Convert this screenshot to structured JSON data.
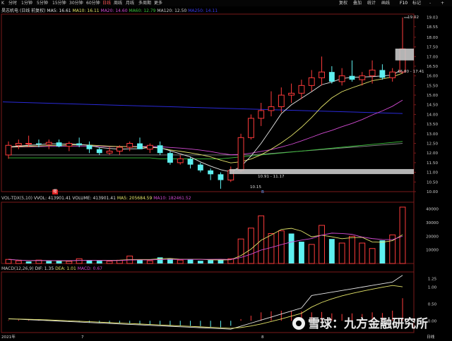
{
  "toolbar": {
    "back": "K",
    "tabs": [
      "分时",
      "1分钟",
      "5分钟",
      "15分钟",
      "30分钟",
      "60分钟",
      "日线",
      "周线",
      "月线",
      "多周期",
      "更多"
    ],
    "active_tab": "日线",
    "right_buttons": [
      "复权",
      "叠加",
      "统计",
      "画线",
      "F10",
      "标记",
      "-",
      "+"
    ]
  },
  "ma_info": {
    "stock": "昊志机电 (日线 前复权)",
    "ma5": "MA5: 16.61",
    "ma10": "MA10: 16.11",
    "ma20": "MA20: 14.60",
    "ma60": "MA60: 12.79",
    "ma120": "MA120: 12.50",
    "ma250": "MA250: 14.11"
  },
  "vol_info": {
    "title": "VOL-TDX(5,10)",
    "vvol": "VVOL: 413901.41",
    "volume": "VOLUME: 413901.41",
    "ma5": "MA5: 205684.59",
    "ma10": "MA10: 182461.52"
  },
  "macd_info": {
    "title": "MACD(12,26,9)",
    "dif": "DIF: 1.35",
    "dea": "DEA: 1.01",
    "macd": "MACD: 0.67"
  },
  "price_axis": [
    "19.03",
    "18.55",
    "18.00",
    "17.50",
    "17.00",
    "16.50",
    "16.00",
    "15.50",
    "15.00",
    "14.50",
    "14.00",
    "13.50",
    "13.00",
    "12.50",
    "12.00",
    "11.50",
    "11.00",
    "10.50",
    "10.00"
  ],
  "vol_axis": [
    "40000",
    "30000",
    "20000",
    "10000"
  ],
  "macd_axis": [
    "1.25",
    "1.00",
    "0.50",
    "0.00"
  ],
  "annotations": {
    "high": "19.02",
    "zone_high": "16.80 - 17.41",
    "zone_low": "10.91 - 11.17",
    "low": "10.15",
    "event_mark": "增",
    "event_mark2": "B"
  },
  "x_labels": [
    "2021年",
    "7",
    "8"
  ],
  "bottom_right": "日线",
  "watermark": "雪球：九方金融研究所",
  "colors": {
    "up": "#ff3b3b",
    "down": "#5ef0f0",
    "ma5": "#e8e8e8",
    "ma10": "#e6e66a",
    "ma20": "#d24bd2",
    "ma60": "#3cc43c",
    "ma120": "#8a8a8a",
    "ma250": "#2a2ad8",
    "zone": "#c8c8c8"
  },
  "chart_data": {
    "type": "candlestick",
    "candles": [
      {
        "o": 11.9,
        "h": 12.6,
        "l": 11.7,
        "c": 12.4
      },
      {
        "o": 12.4,
        "h": 12.7,
        "l": 12.2,
        "c": 12.5
      },
      {
        "o": 12.5,
        "h": 12.9,
        "l": 12.3,
        "c": 12.5
      },
      {
        "o": 12.5,
        "h": 12.7,
        "l": 12.3,
        "c": 12.45
      },
      {
        "o": 12.45,
        "h": 12.7,
        "l": 12.2,
        "c": 12.55
      },
      {
        "o": 12.55,
        "h": 12.7,
        "l": 12.3,
        "c": 12.35
      },
      {
        "o": 12.35,
        "h": 12.6,
        "l": 12.1,
        "c": 12.5
      },
      {
        "o": 12.5,
        "h": 12.8,
        "l": 12.3,
        "c": 12.4
      },
      {
        "o": 12.4,
        "h": 12.6,
        "l": 12.0,
        "c": 12.2
      },
      {
        "o": 12.2,
        "h": 12.3,
        "l": 11.9,
        "c": 12.0
      },
      {
        "o": 12.0,
        "h": 12.3,
        "l": 11.9,
        "c": 12.1
      },
      {
        "o": 12.1,
        "h": 12.4,
        "l": 11.9,
        "c": 12.3
      },
      {
        "o": 12.3,
        "h": 12.6,
        "l": 12.1,
        "c": 12.5
      },
      {
        "o": 12.5,
        "h": 12.8,
        "l": 12.3,
        "c": 12.2
      },
      {
        "o": 12.2,
        "h": 12.5,
        "l": 12.0,
        "c": 12.4
      },
      {
        "o": 12.4,
        "h": 12.6,
        "l": 11.9,
        "c": 12.0
      },
      {
        "o": 12.0,
        "h": 12.1,
        "l": 11.4,
        "c": 11.5
      },
      {
        "o": 11.5,
        "h": 11.9,
        "l": 11.4,
        "c": 11.7
      },
      {
        "o": 11.7,
        "h": 11.8,
        "l": 11.2,
        "c": 11.4
      },
      {
        "o": 11.4,
        "h": 11.5,
        "l": 11.0,
        "c": 11.1
      },
      {
        "o": 11.1,
        "h": 11.2,
        "l": 10.6,
        "c": 10.9
      },
      {
        "o": 10.9,
        "h": 11.0,
        "l": 10.15,
        "c": 10.6
      },
      {
        "o": 10.6,
        "h": 11.3,
        "l": 10.5,
        "c": 11.1
      },
      {
        "o": 11.1,
        "h": 13.0,
        "l": 11.0,
        "c": 12.8
      },
      {
        "o": 12.8,
        "h": 14.0,
        "l": 12.7,
        "c": 13.8
      },
      {
        "o": 13.8,
        "h": 14.6,
        "l": 13.4,
        "c": 14.2
      },
      {
        "o": 14.2,
        "h": 15.2,
        "l": 13.9,
        "c": 14.4
      },
      {
        "o": 14.4,
        "h": 15.4,
        "l": 14.1,
        "c": 15.0
      },
      {
        "o": 15.0,
        "h": 15.6,
        "l": 14.6,
        "c": 15.1
      },
      {
        "o": 15.1,
        "h": 15.8,
        "l": 14.8,
        "c": 15.5
      },
      {
        "o": 15.5,
        "h": 16.3,
        "l": 15.2,
        "c": 15.9
      },
      {
        "o": 15.9,
        "h": 17.0,
        "l": 15.5,
        "c": 16.2
      },
      {
        "o": 16.2,
        "h": 16.5,
        "l": 15.6,
        "c": 15.7
      },
      {
        "o": 15.7,
        "h": 16.4,
        "l": 15.5,
        "c": 16.0
      },
      {
        "o": 16.0,
        "h": 16.8,
        "l": 15.7,
        "c": 15.8
      },
      {
        "o": 15.8,
        "h": 16.2,
        "l": 15.5,
        "c": 16.0
      },
      {
        "o": 16.0,
        "h": 16.8,
        "l": 15.6,
        "c": 16.3
      },
      {
        "o": 16.3,
        "h": 16.6,
        "l": 15.8,
        "c": 15.9
      },
      {
        "o": 15.9,
        "h": 16.4,
        "l": 15.7,
        "c": 16.2
      },
      {
        "o": 16.2,
        "h": 19.02,
        "l": 16.1,
        "c": 17.4
      }
    ],
    "volume": [
      {
        "v": 3000,
        "up": true
      },
      {
        "v": 2000,
        "up": true
      },
      {
        "v": 1500,
        "up": false
      },
      {
        "v": 2500,
        "up": true
      },
      {
        "v": 1800,
        "up": false
      },
      {
        "v": 2200,
        "up": false
      },
      {
        "v": 1600,
        "up": true
      },
      {
        "v": 3500,
        "up": true
      },
      {
        "v": 2600,
        "up": false
      },
      {
        "v": 2000,
        "up": false
      },
      {
        "v": 1700,
        "up": true
      },
      {
        "v": 2400,
        "up": true
      },
      {
        "v": 5500,
        "up": true
      },
      {
        "v": 3000,
        "up": false
      },
      {
        "v": 2000,
        "up": true
      },
      {
        "v": 4500,
        "up": false
      },
      {
        "v": 3500,
        "up": false
      },
      {
        "v": 2500,
        "up": true
      },
      {
        "v": 3000,
        "up": false
      },
      {
        "v": 2000,
        "up": false
      },
      {
        "v": 2500,
        "up": false
      },
      {
        "v": 2800,
        "up": false
      },
      {
        "v": 3500,
        "up": true
      },
      {
        "v": 18000,
        "up": true
      },
      {
        "v": 26000,
        "up": true
      },
      {
        "v": 35000,
        "up": true
      },
      {
        "v": 22000,
        "up": true
      },
      {
        "v": 24000,
        "up": true
      },
      {
        "v": 22000,
        "up": false
      },
      {
        "v": 16000,
        "up": false
      },
      {
        "v": 14000,
        "up": true
      },
      {
        "v": 28000,
        "up": true
      },
      {
        "v": 18000,
        "up": false
      },
      {
        "v": 15000,
        "up": true
      },
      {
        "v": 20000,
        "up": true
      },
      {
        "v": 15000,
        "up": true
      },
      {
        "v": 11000,
        "up": true
      },
      {
        "v": 17000,
        "up": false
      },
      {
        "v": 21000,
        "up": true
      },
      {
        "v": 41390,
        "up": true
      }
    ],
    "macd_hist": [
      0.02,
      0.03,
      0.02,
      0.01,
      0.0,
      -0.01,
      -0.02,
      -0.03,
      -0.05,
      -0.07,
      -0.08,
      -0.07,
      -0.09,
      -0.1,
      -0.11,
      -0.12,
      -0.13,
      -0.14,
      -0.15,
      -0.16,
      -0.18,
      -0.2,
      -0.15,
      0.05,
      0.15,
      0.25,
      0.28,
      0.3,
      0.3,
      0.28,
      0.25,
      0.26,
      0.22,
      0.2,
      0.22,
      0.2,
      0.25,
      0.23,
      0.3,
      0.67
    ],
    "ylim": [
      10.0,
      19.2
    ]
  }
}
